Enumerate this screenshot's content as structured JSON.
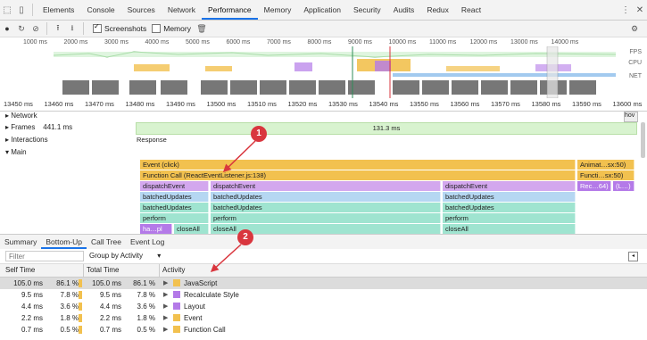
{
  "tabs": [
    "Elements",
    "Console",
    "Sources",
    "Network",
    "Performance",
    "Memory",
    "Application",
    "Security",
    "Audits",
    "Redux",
    "React"
  ],
  "active_tab": "Performance",
  "toolbar": {
    "screenshots_label": "Screenshots",
    "memory_label": "Memory",
    "screenshots_checked": true,
    "memory_checked": false
  },
  "overview": {
    "ticks": [
      "1000 ms",
      "2000 ms",
      "3000 ms",
      "4000 ms",
      "5000 ms",
      "6000 ms",
      "7000 ms",
      "8000 ms",
      "9000 ms",
      "10000 ms",
      "11000 ms",
      "12000 ms",
      "13000 ms",
      "14000 ms"
    ],
    "lanes": [
      "FPS",
      "CPU",
      "NET"
    ]
  },
  "ruler": [
    "13450 ms",
    "13460 ms",
    "13470 ms",
    "13480 ms",
    "13490 ms",
    "13500 ms",
    "13510 ms",
    "13520 ms",
    "13530 ms",
    "13540 ms",
    "13550 ms",
    "13560 ms",
    "13570 ms",
    "13580 ms",
    "13590 ms",
    "13600 ms"
  ],
  "tracks": {
    "network": "Network",
    "frames": "Frames",
    "frames_time": "441.1 ms",
    "frames_bar": "131.3 ms",
    "interactions": "Interactions",
    "interaction_response": "Response",
    "main": "Main",
    "network_edge": "hov"
  },
  "flame": {
    "event_click": "Event (click)",
    "function_call": "Function Call (ReactEventListener.js:138)",
    "animat": "Animat…sx:50)",
    "functi": "Functi…sx:50)",
    "rec": "Rec…64)",
    "l": "(L…)",
    "dispatch": "dispatchEvent",
    "batched": "batchedUpdates",
    "perform": "perform",
    "hapl": "ha…pl",
    "closeall": "closeAll"
  },
  "bottom_tabs": [
    "Summary",
    "Bottom-Up",
    "Call Tree",
    "Event Log"
  ],
  "active_bottom_tab": "Bottom-Up",
  "filter_placeholder": "Filter",
  "group_by": "Group by Activity",
  "columns": {
    "self": "Self Time",
    "total": "Total Time",
    "activity": "Activity"
  },
  "rows": [
    {
      "self_ms": "105.0 ms",
      "self_pct": "86.1 %",
      "total_ms": "105.0 ms",
      "total_pct": "86.1 %",
      "activity": "JavaScript",
      "color": "#f2c14f"
    },
    {
      "self_ms": "9.5 ms",
      "self_pct": "7.8 %",
      "total_ms": "9.5 ms",
      "total_pct": "7.8 %",
      "activity": "Recalculate Style",
      "color": "#b47ae8"
    },
    {
      "self_ms": "4.4 ms",
      "self_pct": "3.6 %",
      "total_ms": "4.4 ms",
      "total_pct": "3.6 %",
      "activity": "Layout",
      "color": "#b47ae8"
    },
    {
      "self_ms": "2.2 ms",
      "self_pct": "1.8 %",
      "total_ms": "2.2 ms",
      "total_pct": "1.8 %",
      "activity": "Event",
      "color": "#f2c14f"
    },
    {
      "self_ms": "0.7 ms",
      "self_pct": "0.5 %",
      "total_ms": "0.7 ms",
      "total_pct": "0.5 %",
      "activity": "Function Call",
      "color": "#f2c14f"
    }
  ],
  "callouts": [
    "1",
    "2"
  ],
  "colors": {
    "accent": "#1a73e8",
    "callout": "#d9363e",
    "scripting": "#f2c14f",
    "rendering": "#b47ae8"
  }
}
